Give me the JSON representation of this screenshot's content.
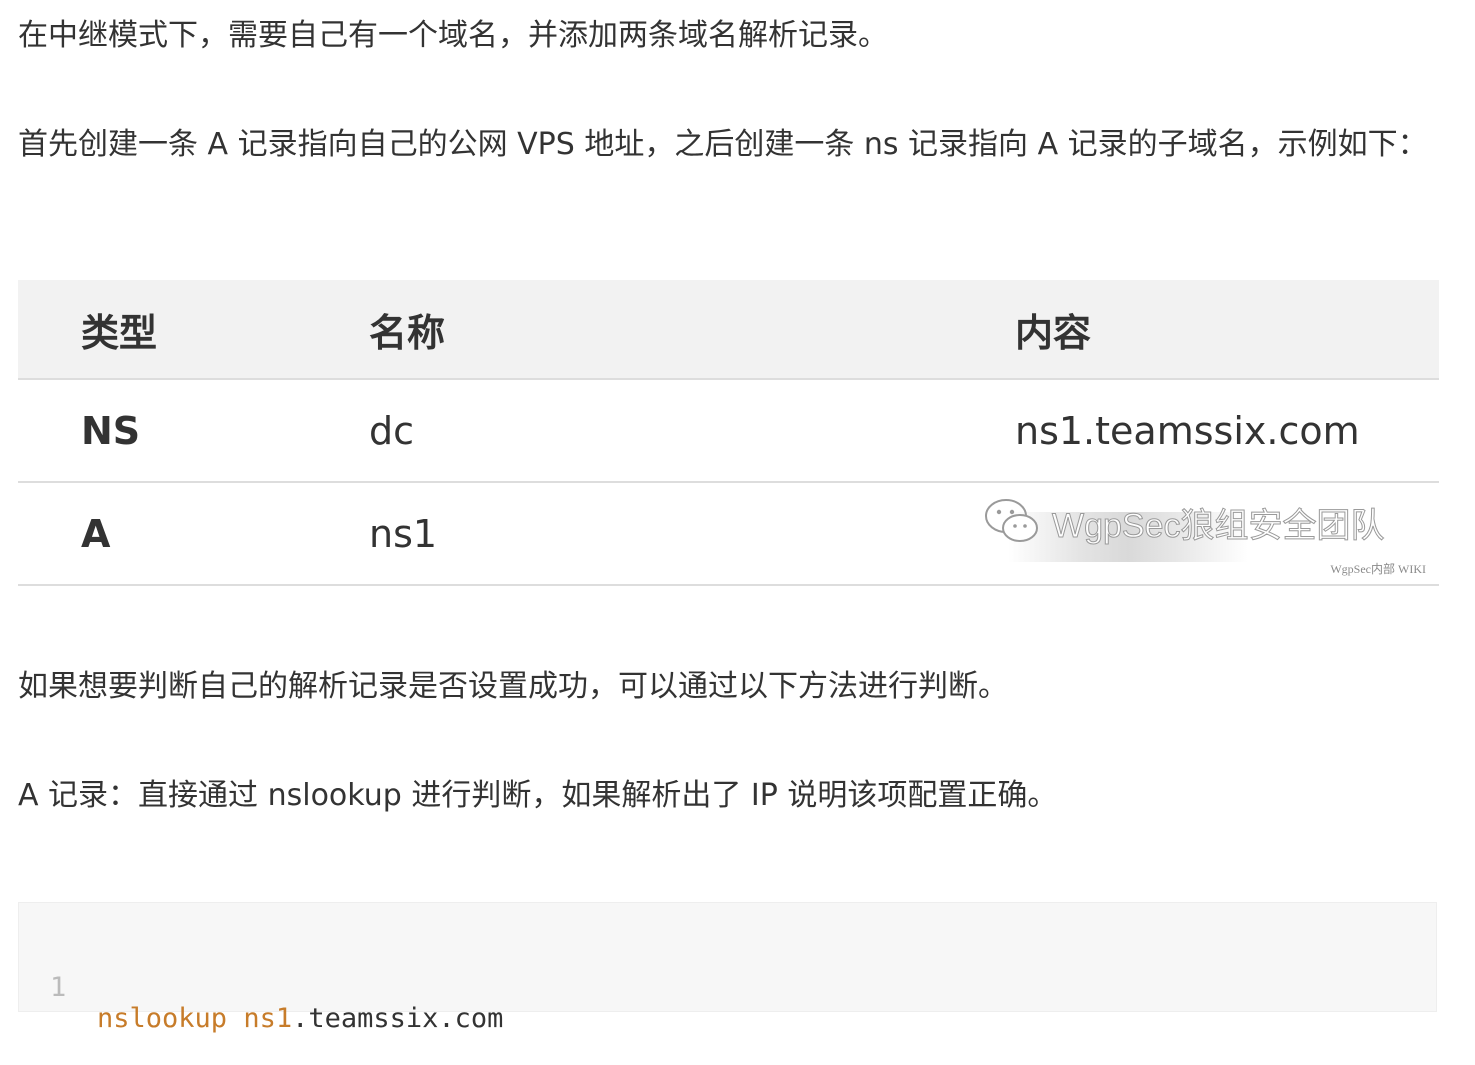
{
  "paragraphs": {
    "p1": "在中继模式下，需要自己有一个域名，并添加两条域名解析记录。",
    "p2": "首先创建一条 A 记录指向自己的公网 VPS 地址，之后创建一条 ns 记录指向 A 记录的子域名，示例如下：",
    "p3": "如果想要判断自己的解析记录是否设置成功，可以通过以下方法进行判断。",
    "p4": "A 记录：直接通过 nslookup 进行判断，如果解析出了 IP 说明该项配置正确。"
  },
  "table": {
    "headers": [
      "类型",
      "名称",
      "内容"
    ],
    "rows": [
      [
        "NS",
        "dc",
        "ns1.teamssix.com"
      ],
      [
        "A",
        "ns1",
        ""
      ]
    ]
  },
  "watermark": {
    "text": "WgpSec狼组安全团队",
    "small": "WgpSec内部 WIKI"
  },
  "code": {
    "line_number": "1",
    "command": "nslookup",
    "arg_highlight": "ns1",
    "arg_rest": ".teamssix.com"
  }
}
